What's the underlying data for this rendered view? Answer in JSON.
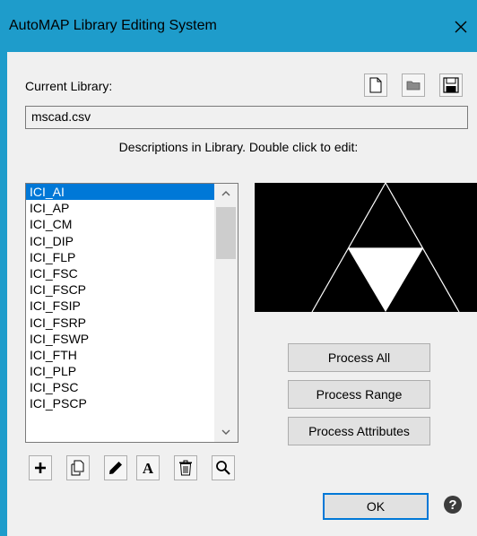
{
  "window": {
    "title": "AutoMAP Library Editing System"
  },
  "library": {
    "current_label": "Current Library:",
    "filename": "mscad.csv",
    "instructions": "Descriptions in Library. Double click to edit:"
  },
  "list": {
    "items": [
      "ICI_AI",
      "ICI_AP",
      "ICI_CM",
      "ICI_DIP",
      "ICI_FLP",
      "ICI_FSC",
      "ICI_FSCP",
      "ICI_FSIP",
      "ICI_FSRP",
      "ICI_FSWP",
      "ICI_FTH",
      "ICI_PLP",
      "ICI_PSC",
      "ICI_PSCP"
    ],
    "selected_index": 0
  },
  "buttons": {
    "process_all": "Process All",
    "process_range": "Process Range",
    "process_attributes": "Process Attributes",
    "ok": "OK"
  },
  "icons": {
    "toolbar": [
      "new-file-icon",
      "open-folder-icon",
      "save-icon"
    ],
    "list_actions": [
      "add-icon",
      "copy-icon",
      "edit-pencil-icon",
      "text-attribute-icon",
      "delete-trash-icon",
      "search-icon"
    ],
    "close": "close-icon",
    "help": "help-icon"
  },
  "colors": {
    "titlebar": "#1e9ccb",
    "selection": "#0078d7",
    "dialog_bg": "#f0f0f0",
    "preview_bg": "#000000"
  }
}
